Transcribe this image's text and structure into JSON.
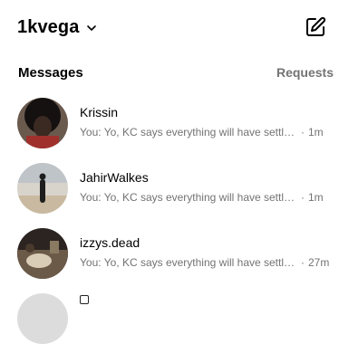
{
  "header": {
    "account_name": "1kvega"
  },
  "section": {
    "title": "Messages",
    "requests_label": "Requests"
  },
  "threads": [
    {
      "name": "Krissin",
      "preview": "You: Yo, KC says everything will have settled down by then",
      "separator": "·",
      "time": "1m"
    },
    {
      "name": "JahirWalkes",
      "preview": "You: Yo, KC says everything will have settled down by then",
      "separator": "·",
      "time": "1m"
    },
    {
      "name": "izzys.dead",
      "preview": "You: Yo, KC says everything will have settled down by then",
      "separator": "·",
      "time": "27m"
    }
  ]
}
